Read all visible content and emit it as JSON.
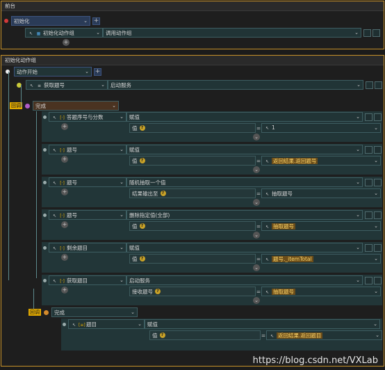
{
  "panel1": {
    "title": "前台",
    "row1_label": "初始化",
    "row2_label": "初始化动作组",
    "row2_value": "调用动作组"
  },
  "panel2": {
    "title": "初始化动作组",
    "event_label": "动作开始",
    "action1_label": "获取题号",
    "action1_value": "启动服务",
    "tag_callback": "回调",
    "complete_label": "完成",
    "steps": [
      {
        "label": "答题序号与分数",
        "action": "赋值",
        "param": "值",
        "value": "1",
        "hl": false
      },
      {
        "label": "题号",
        "action": "赋值",
        "param": "值",
        "value": "返回结果.返回题号",
        "hl": true
      },
      {
        "label": "题号",
        "action": "随机抽取一个值",
        "param": "结果输出至",
        "value": "抽取题号",
        "hl": false
      },
      {
        "label": "题号",
        "action": "删除指定值(全部)",
        "param": "值",
        "value": "抽取题号",
        "hl": true
      },
      {
        "label": "剩余题目",
        "action": "赋值",
        "param": "值",
        "value": "题号._itemTotal",
        "hl": true
      },
      {
        "label": "获取题目",
        "action": "启动服务",
        "param": "接收题号",
        "value": "抽取题号",
        "hl": true
      }
    ],
    "tag_callback2": "回调",
    "complete2_label": "完成",
    "last": {
      "label": "题目",
      "action": "赋值",
      "param": "值",
      "value": "返回结果.返回题目"
    }
  },
  "watermark": "https://blog.csdn.net/VXLab"
}
